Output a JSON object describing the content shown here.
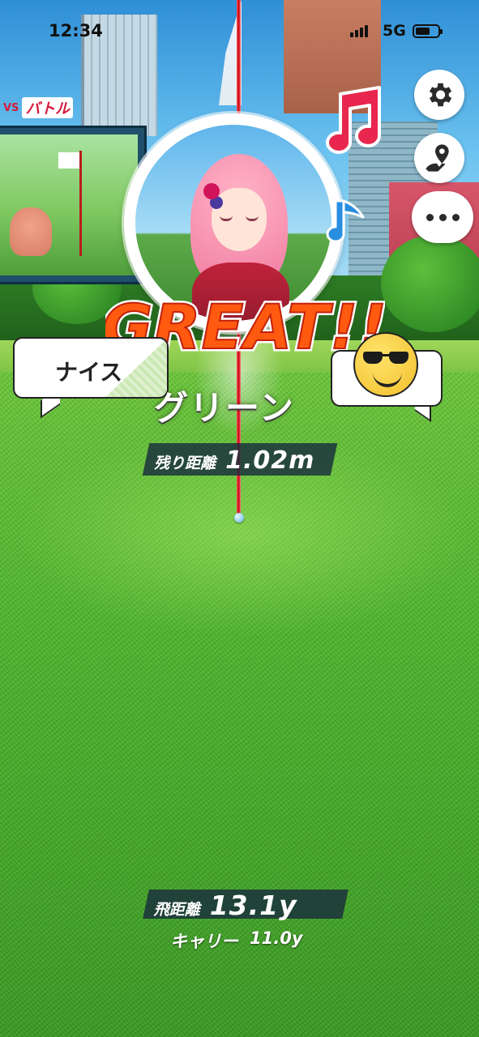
{
  "status_bar": {
    "time": "12:34",
    "network": "5G",
    "battery_level": 0.65
  },
  "billboard": {
    "logo_vs": "VS",
    "logo_text": "バトル"
  },
  "result": {
    "rating": "GREAT!!",
    "lie": "グリーン"
  },
  "reactions": {
    "left_bubble": "ナイス",
    "right_bubble_icon": "sunglasses-emoji-icon"
  },
  "distances": {
    "remaining_label": "残り距離",
    "remaining_value": "1.02m",
    "flight_label": "飛距離",
    "flight_value": "13.1y",
    "carry_label": "キャリー",
    "carry_value": "11.0y"
  },
  "buttons": {
    "settings_icon": "gear-icon",
    "map_icon": "map-pin-icon",
    "chat_icon": "chat-dots-icon"
  },
  "colors": {
    "accent": "#d61a3c",
    "great_fill": "#ff6a1a",
    "panel": "#192d3c"
  }
}
